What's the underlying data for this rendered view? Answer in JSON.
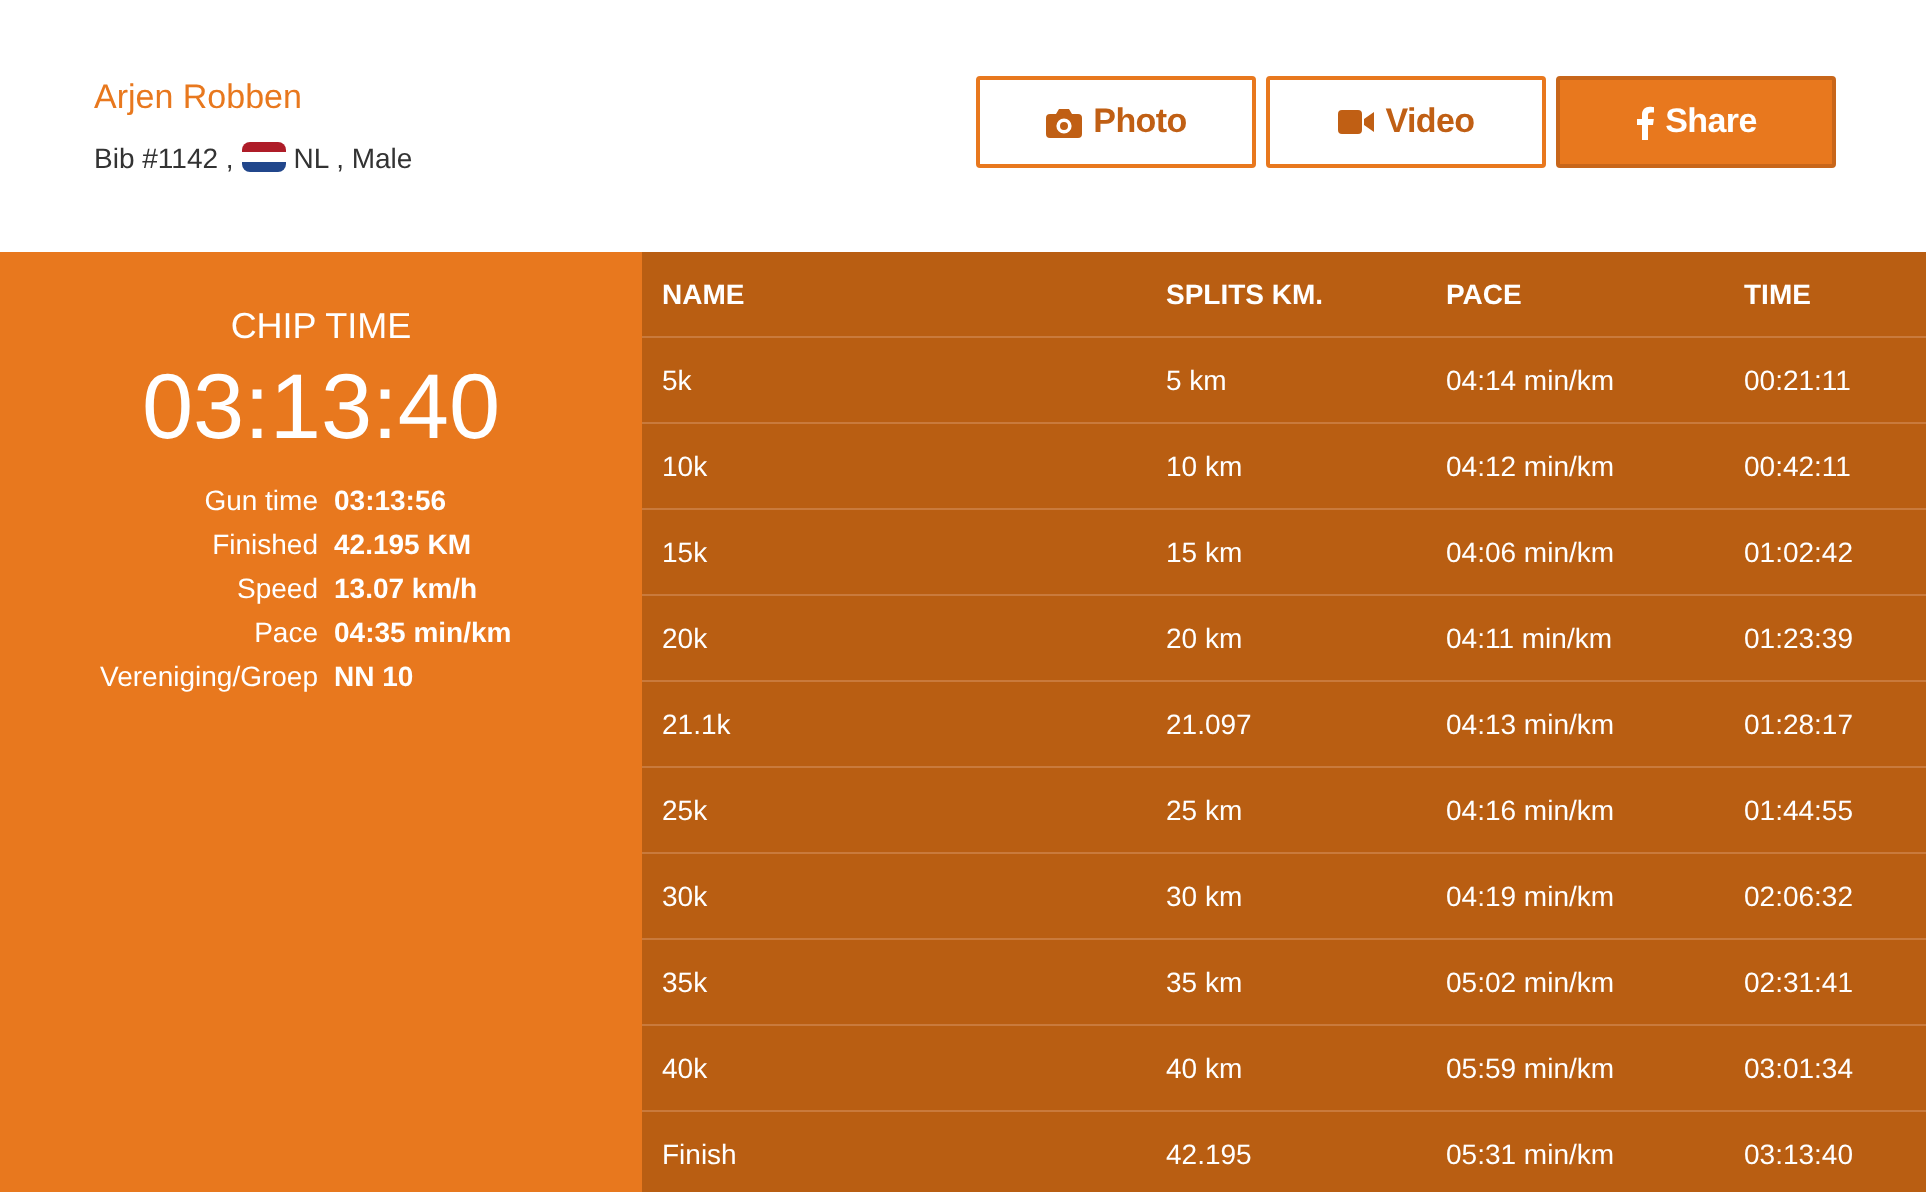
{
  "runner": {
    "name": "Arjen Robben",
    "bib": "Bib #1142 ,",
    "details": "NL , Male"
  },
  "buttons": [
    {
      "label": "Photo",
      "kind": "camera",
      "filled": false
    },
    {
      "label": "Video",
      "kind": "video",
      "filled": false
    },
    {
      "label": "Share",
      "kind": "facebook",
      "filled": true
    }
  ],
  "summary": {
    "title": "CHIP TIME",
    "time": "03:13:40",
    "stats": [
      {
        "label": "Gun time",
        "value": "03:13:56"
      },
      {
        "label": "Finished",
        "value": "42.195 KM"
      },
      {
        "label": "Speed",
        "value": "13.07 km/h"
      },
      {
        "label": "Pace",
        "value": "04:35 min/km"
      },
      {
        "label": "Vereniging/Groep",
        "value": "NN 10"
      }
    ]
  },
  "splits": {
    "columns": [
      "NAME",
      "SPLITS KM.",
      "PACE",
      "TIME"
    ],
    "rows": [
      [
        "5k",
        "5 km",
        "04:14 min/km",
        "00:21:11"
      ],
      [
        "10k",
        "10 km",
        "04:12 min/km",
        "00:42:11"
      ],
      [
        "15k",
        "15 km",
        "04:06 min/km",
        "01:02:42"
      ],
      [
        "20k",
        "20 km",
        "04:11 min/km",
        "01:23:39"
      ],
      [
        "21.1k",
        "21.097",
        "04:13 min/km",
        "01:28:17"
      ],
      [
        "25k",
        "25 km",
        "04:16 min/km",
        "01:44:55"
      ],
      [
        "30k",
        "30 km",
        "04:19 min/km",
        "02:06:32"
      ],
      [
        "35k",
        "35 km",
        "05:02 min/km",
        "02:31:41"
      ],
      [
        "40k",
        "40 km",
        "05:59 min/km",
        "03:01:34"
      ],
      [
        "Finish",
        "42.195",
        "05:31 min/km",
        "03:13:40"
      ]
    ]
  }
}
